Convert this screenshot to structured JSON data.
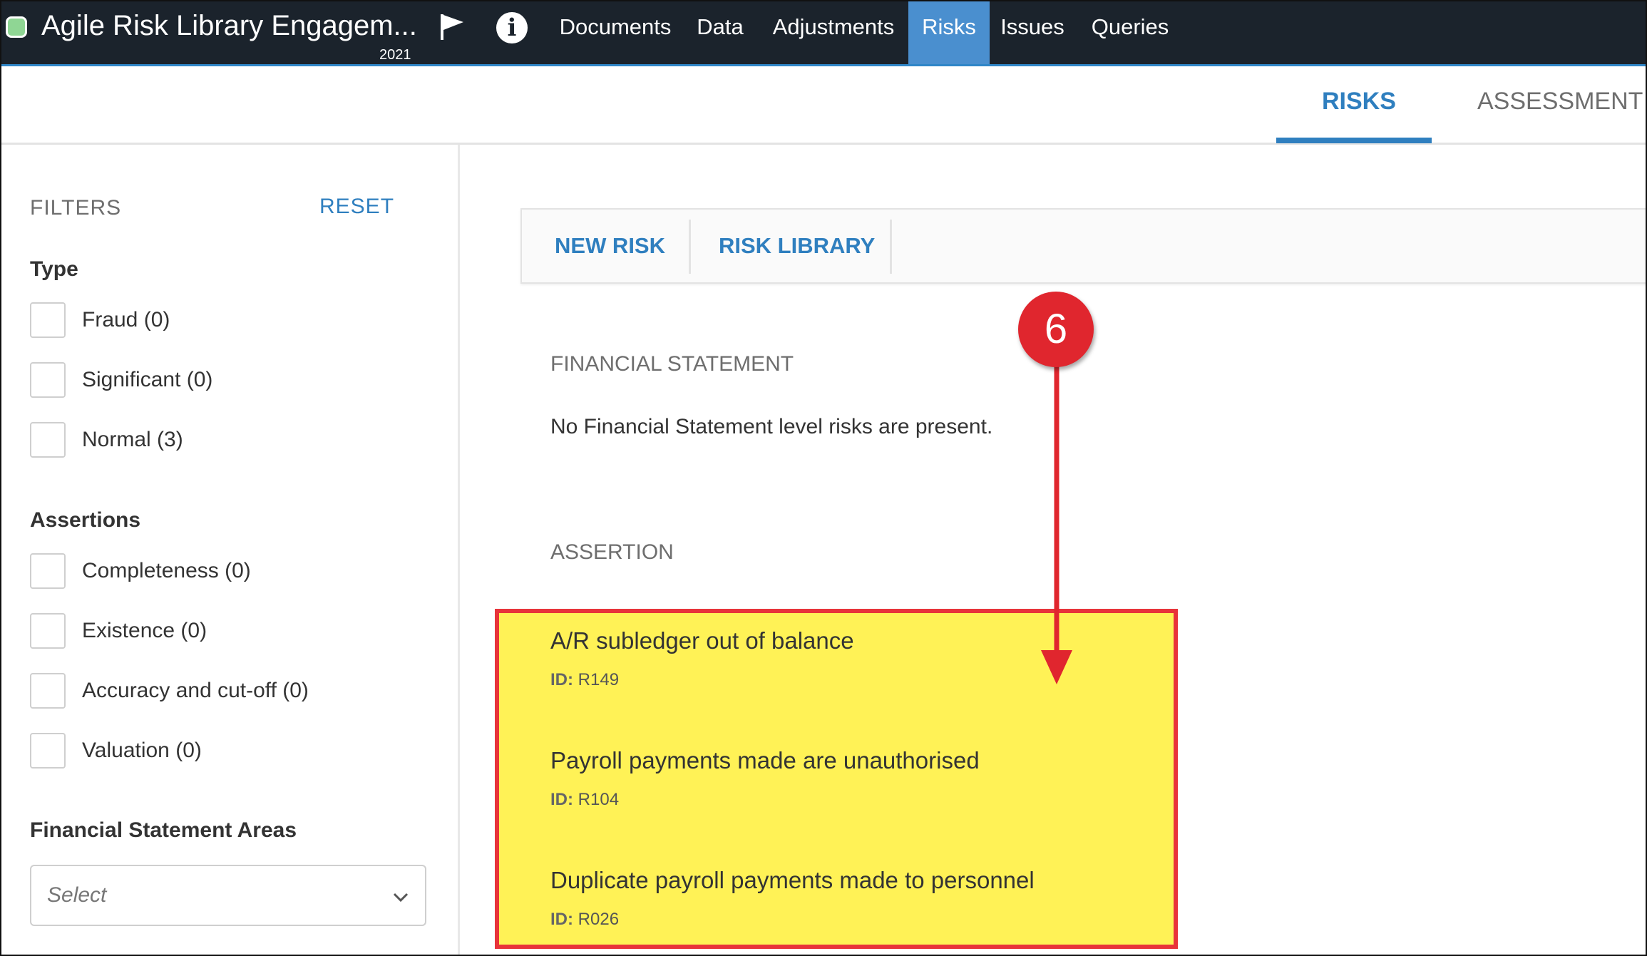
{
  "app": {
    "title": "Agile Risk Library Engagem...",
    "year": "2021",
    "status_color": "#8fd694"
  },
  "nav": {
    "items": [
      {
        "label": "Documents",
        "active": false
      },
      {
        "label": "Data",
        "active": false
      },
      {
        "label": "Adjustments",
        "active": false
      },
      {
        "label": "Risks",
        "active": true
      },
      {
        "label": "Issues",
        "active": false
      },
      {
        "label": "Queries",
        "active": false
      }
    ],
    "icons": [
      "flag-icon",
      "info-icon"
    ],
    "info_glyph": "i"
  },
  "tabs": [
    {
      "label": "RISKS",
      "active": true
    },
    {
      "label": "ASSESSMENT",
      "active": false
    }
  ],
  "filters": {
    "title": "FILTERS",
    "reset_label": "RESET",
    "type": {
      "title": "Type",
      "options": [
        "Fraud (0)",
        "Significant (0)",
        "Normal (3)"
      ]
    },
    "assertions": {
      "title": "Assertions",
      "options": [
        "Completeness (0)",
        "Existence (0)",
        "Accuracy and cut-off (0)",
        "Valuation (0)"
      ]
    },
    "fs_areas": {
      "title": "Financial Statement Areas",
      "placeholder": "Select"
    }
  },
  "actions": {
    "new_risk": "NEW RISK",
    "risk_library": "RISK LIBRARY"
  },
  "sections": {
    "financial_statement": {
      "title": "FINANCIAL STATEMENT",
      "empty_text": "No Financial Statement level risks are present."
    },
    "assertion": {
      "title": "ASSERTION",
      "id_prefix": "ID:",
      "risks": [
        {
          "title": "A/R subledger out of balance",
          "id": "R149"
        },
        {
          "title": "Payroll payments made are unauthorised",
          "id": "R104"
        },
        {
          "title": "Duplicate payroll payments made to personnel",
          "id": "R026"
        }
      ]
    }
  },
  "callout": {
    "number": "6",
    "color": "#e0262e",
    "highlight_color": "#fff256"
  }
}
